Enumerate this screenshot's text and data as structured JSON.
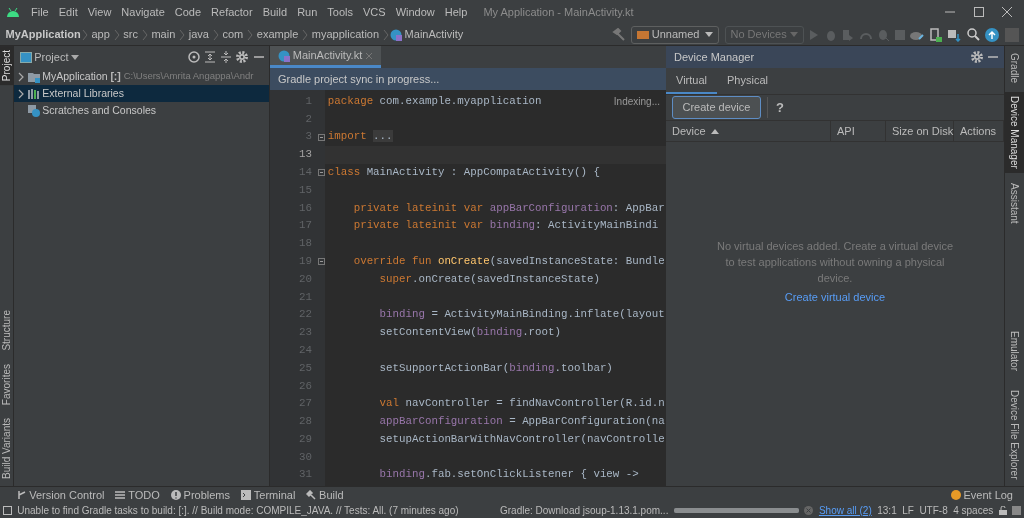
{
  "window": {
    "title": "My Application - MainActivity.kt"
  },
  "menu": [
    "File",
    "Edit",
    "View",
    "Navigate",
    "Code",
    "Refactor",
    "Build",
    "Run",
    "Tools",
    "VCS",
    "Window",
    "Help"
  ],
  "breadcrumb": {
    "project": "MyApplication",
    "path": [
      "app",
      "src",
      "main",
      "java",
      "com",
      "example",
      "myapplication"
    ],
    "file": "MainActivity"
  },
  "toolbar": {
    "configuration": "Unnamed",
    "device": {
      "label": "No Devices",
      "disabled": true
    }
  },
  "left_strip": {
    "top": [
      {
        "label": "Project",
        "selected": true
      }
    ],
    "bottom": [
      {
        "label": "Structure",
        "selected": false
      },
      {
        "label": "Favorites",
        "selected": false
      },
      {
        "label": "Build Variants",
        "selected": false
      }
    ]
  },
  "project_panel": {
    "title": "Project",
    "tree": [
      {
        "label": "MyApplication",
        "module": "[:]",
        "path": "C:\\Users\\Amrita Angappa\\Andr",
        "kind": "module",
        "expandable": true,
        "selected": false
      },
      {
        "label": "External Libraries",
        "kind": "libraries",
        "expandable": true,
        "selected": true
      },
      {
        "label": "Scratches and Consoles",
        "kind": "scratches",
        "expandable": false,
        "selected": false
      }
    ]
  },
  "editor": {
    "tabs": [
      {
        "label": "MainActivity.kt",
        "selected": true
      }
    ],
    "banner": "Gradle project sync in progress...",
    "indexing": "Indexing...",
    "lines": [
      {
        "number": "1",
        "current": false,
        "fold": false,
        "tokens": [
          {
            "kind": "keyword",
            "text": "package"
          },
          {
            "kind": "plain",
            "text": " com.example.myapplication"
          }
        ]
      },
      {
        "number": "2",
        "current": false,
        "fold": false
      },
      {
        "number": "3",
        "current": false,
        "fold": true,
        "tokens": [
          {
            "kind": "keyword",
            "text": "import "
          },
          {
            "kind": "folded",
            "text": "..."
          }
        ]
      },
      {
        "number": "13",
        "current": true,
        "fold": false
      },
      {
        "number": "14",
        "current": false,
        "fold": true,
        "tokens": [
          {
            "kind": "keyword",
            "text": "class"
          },
          {
            "kind": "plain",
            "text": " MainActivity : AppCompatActivity() {"
          }
        ]
      },
      {
        "number": "15",
        "current": false,
        "fold": false
      },
      {
        "number": "16",
        "current": false,
        "fold": false,
        "tokens": [
          {
            "kind": "keyword",
            "text": "    private lateinit var"
          },
          {
            "kind": "property",
            "text": " appBarConfiguration"
          },
          {
            "kind": "plain",
            "text": ": AppBar"
          }
        ]
      },
      {
        "number": "17",
        "current": false,
        "fold": false,
        "tokens": [
          {
            "kind": "keyword",
            "text": "    private lateinit var"
          },
          {
            "kind": "property",
            "text": " binding"
          },
          {
            "kind": "plain",
            "text": ": ActivityMainBindi"
          }
        ]
      },
      {
        "number": "18",
        "current": false,
        "fold": false
      },
      {
        "number": "19",
        "current": false,
        "fold": true,
        "tokens": [
          {
            "kind": "keyword",
            "text": "    override fun "
          },
          {
            "kind": "function",
            "text": "onCreate"
          },
          {
            "kind": "plain",
            "text": "(savedInstanceState: Bundle"
          }
        ]
      },
      {
        "number": "20",
        "current": false,
        "fold": false,
        "tokens": [
          {
            "kind": "keyword",
            "text": "        super"
          },
          {
            "kind": "plain",
            "text": ".onCreate(savedInstanceState)"
          }
        ]
      },
      {
        "number": "21",
        "current": false,
        "fold": false
      },
      {
        "number": "22",
        "current": false,
        "fold": false,
        "tokens": [
          {
            "kind": "property",
            "text": "        binding"
          },
          {
            "kind": "plain",
            "text": " = ActivityMainBinding.inflate(layout"
          }
        ]
      },
      {
        "number": "23",
        "current": false,
        "fold": false,
        "tokens": [
          {
            "kind": "plain",
            "text": "        setContentView("
          },
          {
            "kind": "property",
            "text": "binding"
          },
          {
            "kind": "plain",
            "text": ".root)"
          }
        ]
      },
      {
        "number": "24",
        "current": false,
        "fold": false
      },
      {
        "number": "25",
        "current": false,
        "fold": false,
        "tokens": [
          {
            "kind": "plain",
            "text": "        setSupportActionBar("
          },
          {
            "kind": "property",
            "text": "binding"
          },
          {
            "kind": "plain",
            "text": ".toolbar)"
          }
        ]
      },
      {
        "number": "26",
        "current": false,
        "fold": false
      },
      {
        "number": "27",
        "current": false,
        "fold": false,
        "tokens": [
          {
            "kind": "keyword",
            "text": "        val"
          },
          {
            "kind": "plain",
            "text": " navController = findNavController(R.id.n"
          }
        ]
      },
      {
        "number": "28",
        "current": false,
        "fold": false,
        "tokens": [
          {
            "kind": "property",
            "text": "        appBarConfiguration"
          },
          {
            "kind": "plain",
            "text": " = AppBarConfiguration(na"
          }
        ]
      },
      {
        "number": "29",
        "current": false,
        "fold": false,
        "tokens": [
          {
            "kind": "plain",
            "text": "        setupActionBarWithNavController(navControlle"
          }
        ]
      },
      {
        "number": "30",
        "current": false,
        "fold": false
      },
      {
        "number": "31",
        "current": false,
        "fold": false,
        "tokens": [
          {
            "kind": "property",
            "text": "        binding"
          },
          {
            "kind": "plain",
            "text": ".fab.setOnClickListener { view ->"
          }
        ]
      }
    ]
  },
  "device_manager": {
    "title": "Device Manager",
    "tabs": [
      {
        "label": "Virtual",
        "selected": true
      },
      {
        "label": "Physical",
        "selected": false
      }
    ],
    "create_button": "Create device",
    "help": "?",
    "columns": [
      {
        "label": "Device",
        "sorted": true
      },
      {
        "label": "API",
        "sorted": false
      },
      {
        "label": "Size on Disk",
        "sorted": false
      },
      {
        "label": "Actions",
        "sorted": false
      }
    ],
    "empty_message": "No virtual devices added. Create a virtual device to test applications without owning a physical device.",
    "create_link": "Create virtual device"
  },
  "right_strip": {
    "top": [
      {
        "label": "Gradle",
        "selected": false
      },
      {
        "label": "Device Manager",
        "selected": true
      },
      {
        "label": "Assistant",
        "selected": false
      }
    ],
    "bottom": [
      {
        "label": "Emulator",
        "selected": false
      },
      {
        "label": "Device File Explorer",
        "selected": false
      }
    ]
  },
  "bottom_tools": [
    {
      "label": "Version Control",
      "kind": "vcs"
    },
    {
      "label": "TODO",
      "kind": "todo"
    },
    {
      "label": "Problems",
      "kind": "problems"
    },
    {
      "label": "Terminal",
      "kind": "terminal"
    },
    {
      "label": "Build",
      "kind": "build"
    }
  ],
  "event_log": "Event Log",
  "status_bar": {
    "message": "Unable to find Gradle tasks to build: [:]. // Build mode: COMPILE_JAVA. // Tests: All. (7 minutes ago)",
    "task": "Gradle: Download jsoup-1.13.1.pom...",
    "task_progress": {
      "level": 1
    },
    "show_all": "Show all (2)",
    "caret": "13:1",
    "line_separator": "LF",
    "encoding": "UTF-8",
    "indent": "4 spaces"
  }
}
